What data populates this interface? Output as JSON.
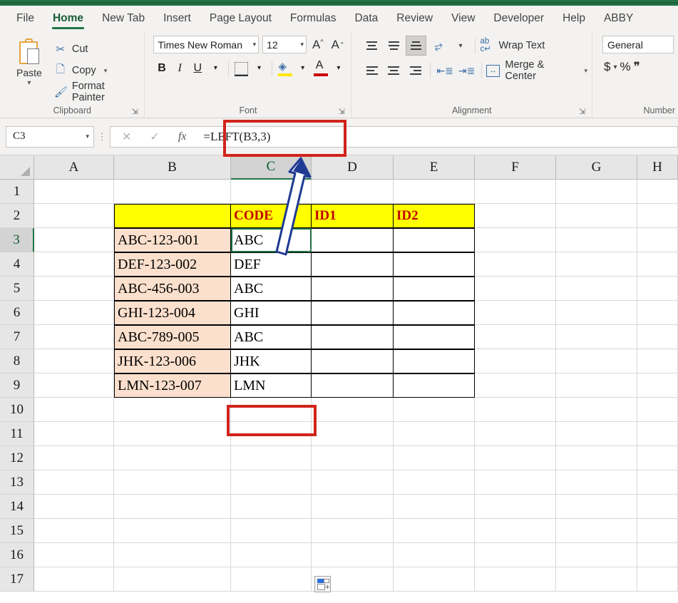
{
  "app": {
    "accent_green": "#217346"
  },
  "tabs": [
    {
      "label": "File",
      "active": false
    },
    {
      "label": "Home",
      "active": true
    },
    {
      "label": "New Tab",
      "active": false
    },
    {
      "label": "Insert",
      "active": false
    },
    {
      "label": "Page Layout",
      "active": false
    },
    {
      "label": "Formulas",
      "active": false
    },
    {
      "label": "Data",
      "active": false
    },
    {
      "label": "Review",
      "active": false
    },
    {
      "label": "View",
      "active": false
    },
    {
      "label": "Developer",
      "active": false
    },
    {
      "label": "Help",
      "active": false
    },
    {
      "label": "ABBY",
      "active": false
    }
  ],
  "ribbon": {
    "clipboard": {
      "group_label": "Clipboard",
      "paste_label": "Paste",
      "cut_label": "Cut",
      "copy_label": "Copy",
      "format_painter_label": "Format Painter"
    },
    "font": {
      "group_label": "Font",
      "font_name": "Times New Roman",
      "font_size": "12",
      "bold_label": "B",
      "italic_label": "I",
      "underline_label": "U",
      "grow_font_label": "A",
      "shrink_font_label": "A",
      "fill_color": "#ffe600",
      "font_color": "#cc0000"
    },
    "alignment": {
      "group_label": "Alignment",
      "wrap_text_label": "Wrap Text",
      "merge_center_label": "Merge & Center",
      "wrap_icon_text": "ab"
    },
    "number": {
      "group_label": "Number",
      "format": "General",
      "currency_label": "$",
      "percent_label": "%",
      "comma_label": "❞"
    }
  },
  "formula_bar": {
    "name_box": "C3",
    "cancel_label": "✕",
    "enter_label": "✓",
    "fx_label": "fx",
    "formula": "=LEFT(B3,3)",
    "highlight_color": "#d0241b"
  },
  "grid": {
    "columns": [
      "A",
      "B",
      "C",
      "D",
      "E",
      "F",
      "G",
      "H"
    ],
    "selected_column": "C",
    "selected_row": "3",
    "selected_cell": "C3",
    "rows": [
      "1",
      "2",
      "3",
      "4",
      "5",
      "6",
      "7",
      "8",
      "9",
      "10",
      "11",
      "12",
      "13",
      "14",
      "15",
      "16",
      "17"
    ],
    "headers": {
      "c": "CODE",
      "d": "ID1",
      "e": "ID2"
    },
    "data": [
      {
        "row": "3",
        "b": "ABC-123-001",
        "c": "ABC"
      },
      {
        "row": "4",
        "b": "DEF-123-002",
        "c": "DEF"
      },
      {
        "row": "5",
        "b": "ABC-456-003",
        "c": "ABC"
      },
      {
        "row": "6",
        "b": "GHI-123-004",
        "c": "GHI"
      },
      {
        "row": "7",
        "b": "ABC-789-005",
        "c": "ABC"
      },
      {
        "row": "8",
        "b": "JHK-123-006",
        "c": "JHK"
      },
      {
        "row": "9",
        "b": "LMN-123-007",
        "c": "LMN"
      }
    ],
    "header_fill": "#ffff00",
    "header_text_color": "#c00000",
    "data_fill": "#fbe0cd"
  },
  "annotations": {
    "arrow_fill": "#ffffff",
    "arrow_stroke": "#1f3a93",
    "box_color": "#d0241b"
  }
}
